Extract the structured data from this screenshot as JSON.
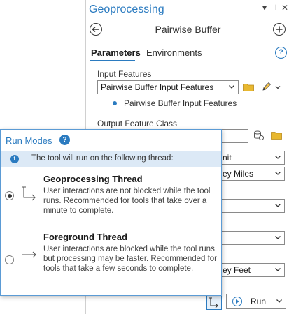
{
  "pane": {
    "title": "Geoprocessing",
    "controls": {
      "dropdown": "▾",
      "pin": "⊥",
      "close": "✕"
    },
    "tool_title": "Pairwise Buffer",
    "tabs": [
      {
        "label": "Parameters",
        "active": true
      },
      {
        "label": "Environments",
        "active": false
      }
    ],
    "input_features": {
      "label": "Input Features",
      "value": "Pairwise Buffer Input Features",
      "list_item": "Pairwise Buffer Input Features"
    },
    "output_feature_class": {
      "label": "Output Feature Class",
      "value": ""
    },
    "partial_values": {
      "distance_unit": "nit",
      "distance_value_unit": "ey Miles",
      "max_offset_unit": "ey Feet"
    },
    "run_button": {
      "label": "Run"
    }
  },
  "run_modes": {
    "title": "Run Modes",
    "info_text": "The tool will run on the following thread:",
    "options": [
      {
        "title": "Geoprocessing Thread",
        "description": "User interactions are not blocked while the tool runs. Recommended for tools that take over a minute to complete.",
        "selected": true
      },
      {
        "title": "Foreground Thread",
        "description": "User interactions are blocked while the tool runs, but processing may be faster. Recommended for tools that take a few seconds to complete.",
        "selected": false
      }
    ]
  },
  "colors": {
    "accent": "#2b7bc0",
    "info_bar": "#dce9f6",
    "folder": "#e8b830"
  }
}
